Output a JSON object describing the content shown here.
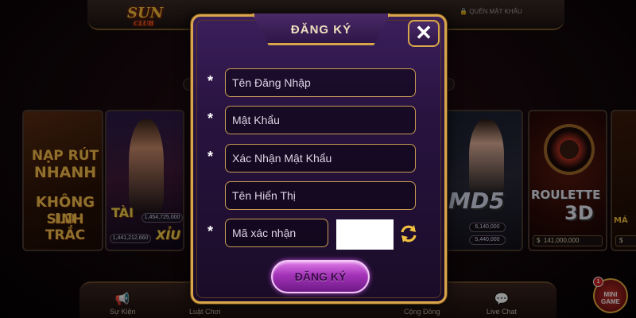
{
  "lobby": {
    "logo": "SUN",
    "logo_sub": "CLUB",
    "forgot_password": "QUÊN MẬT KHẨU",
    "cards": {
      "naprut": [
        "NẠP RÚT",
        "NHANH",
        "KHÔNG LO",
        "SINH TRẮC"
      ],
      "taixiu": {
        "tai": "TÀI",
        "xiu": "XỈU",
        "tai_amount": "1,441,212,660",
        "xiu_amount": "1,454,725,000"
      },
      "md5": {
        "label": "MD5",
        "val1": "6,140,000",
        "val2": "5,440,000"
      },
      "roulette": {
        "line1": "ROULETTE",
        "line2": "3D",
        "money": "141,000,000"
      },
      "edge": {
        "label": "MÁ",
        "money": "$"
      }
    },
    "bottom_nav": [
      {
        "label": "Sự Kiện",
        "icon": "megaphone-icon"
      },
      {
        "label": "Luật Chơi",
        "icon": "rules-icon"
      },
      {
        "label": "Cộng Đồng",
        "icon": "community-icon"
      },
      {
        "label": "Live Chat",
        "icon": "chat-icon"
      }
    ],
    "minigame": {
      "count": "1",
      "line1": "MINI",
      "line2": "GAME"
    }
  },
  "modal": {
    "title": "ĐĂNG KÝ",
    "close_icon": "close-icon",
    "fields": {
      "username": {
        "placeholder": "Tên Đăng Nhập",
        "value": "",
        "required": "*"
      },
      "password": {
        "placeholder": "Mật Khẩu",
        "value": "",
        "required": "*"
      },
      "confirm_password": {
        "placeholder": "Xác Nhận Mật Khẩu",
        "value": "",
        "required": "*"
      },
      "display_name": {
        "placeholder": "Tên Hiển Thị",
        "value": ""
      },
      "captcha": {
        "placeholder": "Mã xác nhận",
        "value": "",
        "required": "*"
      }
    },
    "submit_label": "ĐĂNG KÝ",
    "colors": {
      "gold": "#d7a54a",
      "panel": "#28133f",
      "submit": "#a332b8"
    }
  }
}
